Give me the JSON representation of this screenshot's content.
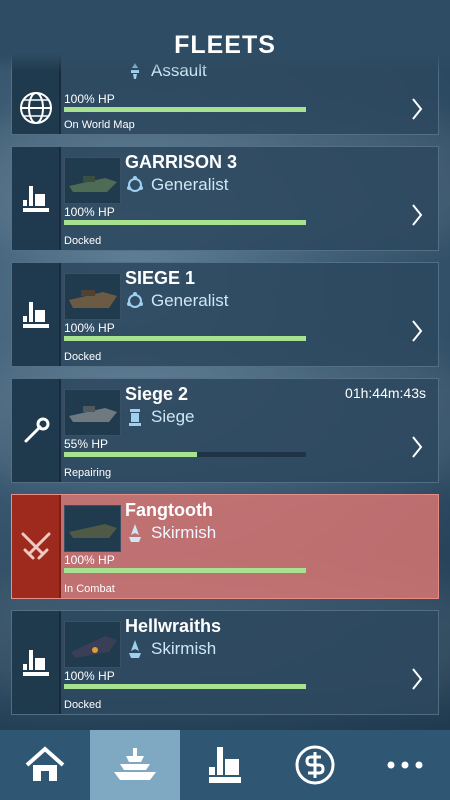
{
  "header": {
    "title": "FLEETS"
  },
  "fleets": [
    {
      "name": "",
      "role": "Assault",
      "hp_label": "100% HP",
      "hp": 1.0,
      "status": "On World Map",
      "timer": ""
    },
    {
      "name": "GARRISON 3",
      "role": "Generalist",
      "hp_label": "100% HP",
      "hp": 1.0,
      "status": "Docked",
      "timer": ""
    },
    {
      "name": "SIEGE 1",
      "role": "Generalist",
      "hp_label": "100% HP",
      "hp": 1.0,
      "status": "Docked",
      "timer": ""
    },
    {
      "name": "Siege 2",
      "role": "Siege",
      "hp_label": "55% HP",
      "hp": 0.55,
      "status": "Repairing",
      "timer": "01h:44m:43s"
    },
    {
      "name": "Fangtooth",
      "role": "Skirmish",
      "hp_label": "100% HP",
      "hp": 1.0,
      "status": "In Combat",
      "timer": ""
    },
    {
      "name": "Hellwraiths",
      "role": "Skirmish",
      "hp_label": "100% HP",
      "hp": 1.0,
      "status": "Docked",
      "timer": ""
    }
  ],
  "icons": {
    "side": [
      "globe-icon",
      "dock-icon",
      "dock-icon",
      "wrench-icon",
      "crossed-swords-icon",
      "dock-icon"
    ],
    "role": [
      "assault-icon",
      "generalist-icon",
      "generalist-icon",
      "siege-tower-icon",
      "skirmish-icon",
      "skirmish-icon"
    ],
    "nav": [
      "home-icon",
      "fleets-icon",
      "docks-icon",
      "store-icon",
      "more-icon"
    ]
  },
  "colors": {
    "hp_bar": "#a6e28f",
    "combat_card": "#e07a74",
    "combat_side": "#9d2a1c",
    "active_tab": "#7fa9c3"
  },
  "nav": {
    "active": "fleets"
  }
}
